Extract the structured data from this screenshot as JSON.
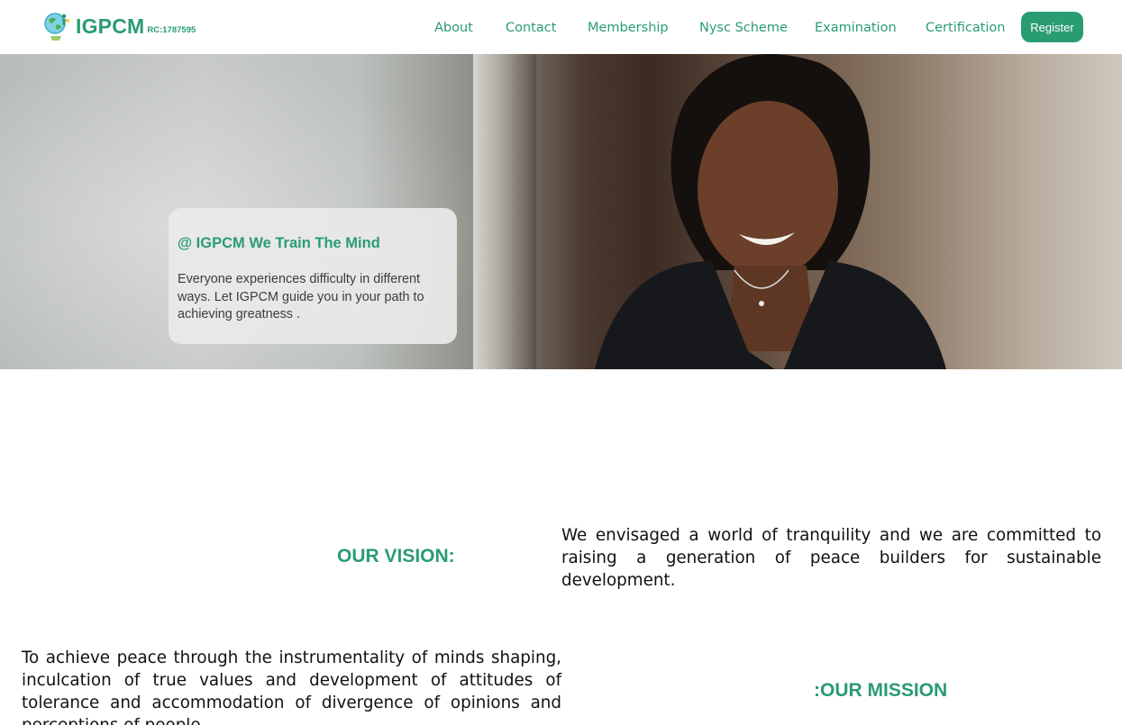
{
  "brand": {
    "name": "IGPCM",
    "rc": "RC:1787595",
    "color": "#2a9c72"
  },
  "nav": {
    "items": [
      {
        "label": "About"
      },
      {
        "label": "Contact"
      },
      {
        "label": "Membership"
      },
      {
        "label": "Nysc Scheme"
      },
      {
        "label": "Examination"
      },
      {
        "label": "Certification"
      }
    ],
    "register_label": "Register"
  },
  "hero": {
    "title": "@ IGPCM We Train The Mind",
    "text": "Everyone experiences difficulty in different ways. Let IGPCM guide you in your path to achieving greatness ."
  },
  "vision": {
    "heading": "OUR VISION:",
    "text": "We envisaged a world of tranquility and we are committed to raising a generation of peace builders for sustainable development."
  },
  "mission": {
    "heading": ":OUR MISSION",
    "text": "To achieve peace through the instrumentality of minds shaping, inculcation of true values and development of attitudes of tolerance and accommodation of divergence of opinions and perceptions of people."
  },
  "icons": {
    "logo": "globe-person-icon"
  }
}
